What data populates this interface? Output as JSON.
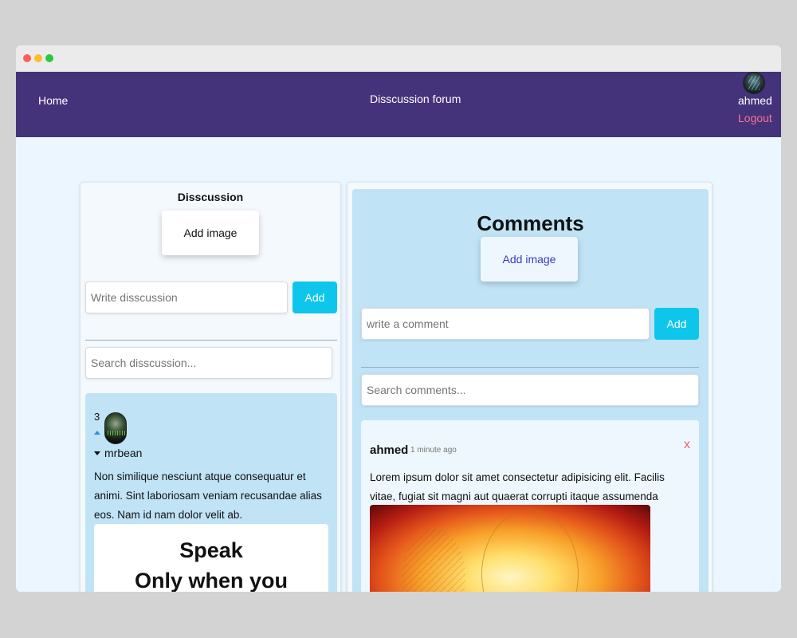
{
  "navbar": {
    "home": "Home",
    "title": "Disscussion forum",
    "username": "ahmed",
    "logout": "Logout"
  },
  "discussion": {
    "title": "Disscussion",
    "add_image": "Add image",
    "input_placeholder": "Write disscussion",
    "add_label": "Add",
    "search_placeholder": "Search disscussion...",
    "post": {
      "votes": "3",
      "author": "mrbean",
      "body": "Non similique nesciunt atque consequatur et animi. Sint laboriosam veniam recusandae alias eos. Nam id nam dolor velit ab.",
      "image_text_line1": "Speak",
      "image_text_line2": "Only when you"
    }
  },
  "comments": {
    "title": "Comments",
    "add_image": "Add image",
    "input_placeholder": "write a comment",
    "add_label": "Add",
    "search_placeholder": "Search comments...",
    "comment": {
      "author": "ahmed",
      "time": "1 minute ago",
      "close": "x",
      "body": "Lorem ipsum dolor sit amet consectetur adipisicing elit. Facilis vitae, fugiat sit magni aut quaerat corrupti itaque assumenda"
    }
  },
  "colors": {
    "navbar": "#44337a",
    "accent": "#0ec6ec",
    "logout": "#f7748d",
    "card": "#c0e3f6"
  }
}
